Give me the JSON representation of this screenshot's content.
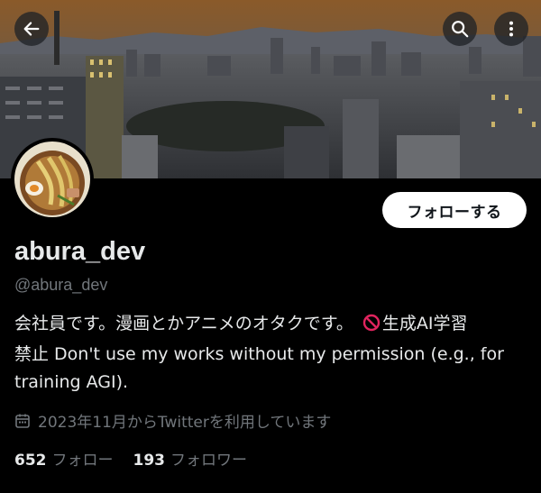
{
  "header": {
    "back_icon": "arrow-left-icon",
    "search_icon": "search-icon",
    "more_icon": "more-vertical-icon"
  },
  "profile": {
    "display_name": "abura_dev",
    "handle": "@abura_dev",
    "follow_label": "フォローする",
    "bio_line1": "会社員です。漫画とかアニメのオタクです。",
    "bio_emoji": "no-entry-emoji",
    "bio_line1_tail": "生成AI学習",
    "bio_rest": "禁止 Don't use my works without my permission (e.g., for training AGI).",
    "joined_icon": "calendar-icon",
    "joined_text": "2023年11月からTwitterを利用しています",
    "following_count": "652",
    "following_label": "フォロー",
    "followers_count": "193",
    "followers_label": "フォロワー"
  },
  "colors": {
    "background": "#000000",
    "text_primary": "#e7e9ea",
    "text_secondary": "#71767b",
    "ban_red": "#e0245e"
  }
}
